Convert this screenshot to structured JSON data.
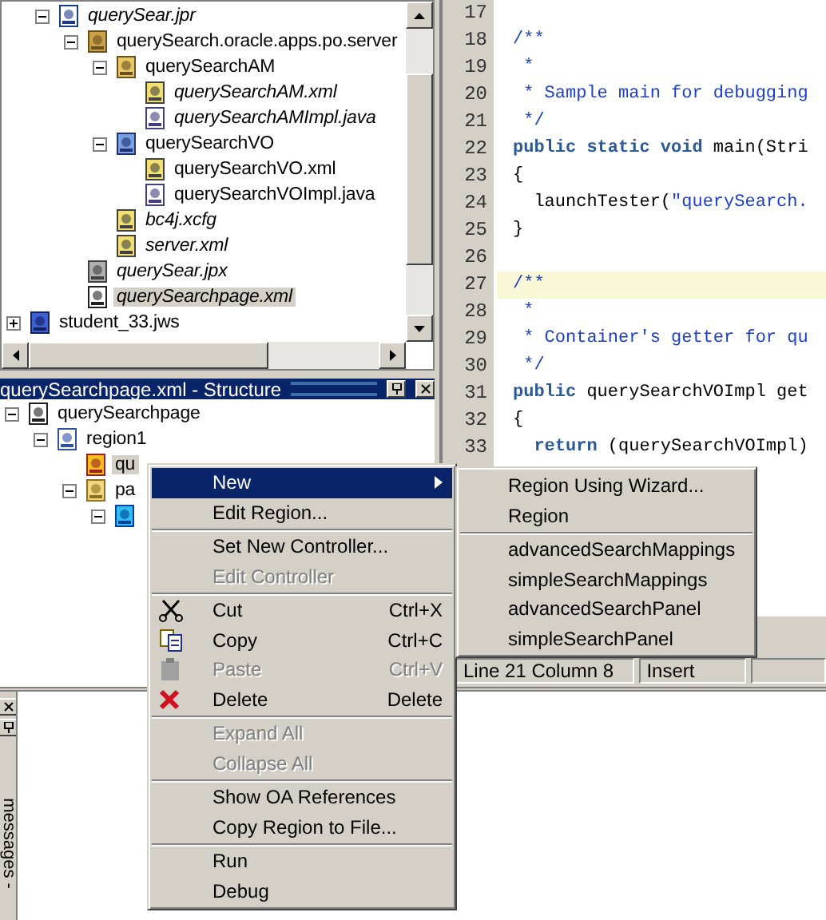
{
  "navigator": {
    "items": [
      {
        "label": "querySear.jpr",
        "kind": "project",
        "italic": true,
        "selected": false,
        "expanded": true,
        "children": [
          {
            "label": "querySearch.oracle.apps.po.server",
            "kind": "package",
            "italic": false,
            "selected": false,
            "expanded": true,
            "children": [
              {
                "label": "querySearchAM",
                "kind": "am",
                "italic": false,
                "selected": false,
                "expanded": true,
                "children": [
                  {
                    "label": "querySearchAM.xml",
                    "kind": "xml",
                    "italic": true,
                    "selected": false
                  },
                  {
                    "label": "querySearchAMImpl.java",
                    "kind": "java",
                    "italic": true,
                    "selected": false
                  }
                ]
              },
              {
                "label": "querySearchVO",
                "kind": "vo",
                "italic": false,
                "selected": false,
                "expanded": true,
                "children": [
                  {
                    "label": "querySearchVO.xml",
                    "kind": "xml",
                    "italic": false,
                    "selected": false
                  },
                  {
                    "label": "querySearchVOImpl.java",
                    "kind": "java",
                    "italic": false,
                    "selected": false
                  }
                ]
              },
              {
                "label": "bc4j.xcfg",
                "kind": "xml",
                "italic": true,
                "selected": false
              },
              {
                "label": "server.xml",
                "kind": "xml",
                "italic": true,
                "selected": false
              }
            ]
          },
          {
            "label": "querySear.jpx",
            "kind": "jpx",
            "italic": true,
            "selected": false
          },
          {
            "label": "querySearchpage.xml",
            "kind": "page",
            "italic": true,
            "selected": true
          }
        ]
      },
      {
        "label": "student_33.jws",
        "kind": "workspace",
        "italic": false,
        "selected": false,
        "expanded": false
      }
    ]
  },
  "structure": {
    "title": "querySearchpage.xml - Structure",
    "items": [
      {
        "label": "querySearchpage",
        "kind": "page",
        "italic": false,
        "selected": false,
        "expanded": true,
        "children": [
          {
            "label": "region1",
            "kind": "region",
            "italic": false,
            "selected": false,
            "expanded": true,
            "children": [
              {
                "label": "qu",
                "kind": "item",
                "italic": false,
                "selected": true
              },
              {
                "label": "pa",
                "kind": "folder",
                "italic": false,
                "selected": false,
                "expanded": true,
                "children": [
                  {
                    "kind": "table",
                    "expanded": true
                  }
                ]
              }
            ]
          }
        ]
      }
    ]
  },
  "editor": {
    "lines": [
      {
        "number": "17",
        "highlighted": false
      },
      {
        "number": "18",
        "highlighted": false,
        "tokens": [
          {
            "kind": "comment",
            "text": "/**"
          }
        ]
      },
      {
        "number": "19",
        "highlighted": false,
        "tokens": [
          {
            "kind": "comment",
            "text": " *"
          }
        ]
      },
      {
        "number": "20",
        "highlighted": false,
        "tokens": [
          {
            "kind": "comment",
            "text": " * Sample main for debugging"
          }
        ]
      },
      {
        "number": "21",
        "highlighted": false,
        "tokens": [
          {
            "kind": "comment",
            "text": " */"
          }
        ]
      },
      {
        "number": "22",
        "highlighted": false,
        "tokens": [
          {
            "kind": "keyword",
            "text": "public static void"
          },
          {
            "kind": "plain",
            "text": " main(Stri"
          }
        ]
      },
      {
        "number": "23",
        "highlighted": false,
        "tokens": [
          {
            "kind": "plain",
            "text": "{"
          }
        ]
      },
      {
        "number": "24",
        "highlighted": false,
        "tokens": [
          {
            "kind": "plain",
            "text": "  launchTester("
          },
          {
            "kind": "string",
            "text": "\"querySearch."
          }
        ]
      },
      {
        "number": "25",
        "highlighted": false,
        "tokens": [
          {
            "kind": "plain",
            "text": "}"
          }
        ]
      },
      {
        "number": "26",
        "highlighted": false
      },
      {
        "number": "27",
        "highlighted": true,
        "tokens": [
          {
            "kind": "comment",
            "text": "/**"
          }
        ]
      },
      {
        "number": "28",
        "highlighted": false,
        "tokens": [
          {
            "kind": "comment",
            "text": " *"
          }
        ]
      },
      {
        "number": "29",
        "highlighted": false,
        "tokens": [
          {
            "kind": "comment",
            "text": " * Container's getter for qu"
          }
        ]
      },
      {
        "number": "30",
        "highlighted": false,
        "tokens": [
          {
            "kind": "comment",
            "text": " */"
          }
        ]
      },
      {
        "number": "31",
        "highlighted": false,
        "tokens": [
          {
            "kind": "keyword",
            "text": "public"
          },
          {
            "kind": "plain",
            "text": " querySearchVOImpl get"
          }
        ]
      },
      {
        "number": "32",
        "highlighted": false,
        "tokens": [
          {
            "kind": "plain",
            "text": "{"
          }
        ]
      },
      {
        "number": "33",
        "highlighted": false,
        "tokens": [
          {
            "kind": "keyword",
            "text": "  return"
          },
          {
            "kind": "plain",
            "text": " (querySearchVOImpl)"
          }
        ]
      }
    ],
    "status": [
      "Line 21 Column 8",
      "Insert"
    ]
  },
  "log_panel": {
    "tab": "messages -"
  },
  "context_menu": [
    {
      "kind": "item",
      "label": "New",
      "submenu": true,
      "selected": true,
      "disabled": false
    },
    {
      "kind": "item",
      "label": "Edit Region...",
      "selected": false,
      "disabled": false
    },
    {
      "kind": "separator"
    },
    {
      "kind": "item",
      "label": "Set New Controller...",
      "selected": false,
      "disabled": false
    },
    {
      "kind": "item",
      "label": "Edit Controller",
      "selected": false,
      "disabled": true
    },
    {
      "kind": "separator"
    },
    {
      "kind": "cut",
      "label": "Cut",
      "shortcut": "Ctrl+X",
      "selected": false,
      "disabled": false
    },
    {
      "kind": "copy",
      "label": "Copy",
      "shortcut": "Ctrl+C",
      "selected": false,
      "disabled": false
    },
    {
      "kind": "paste",
      "label": "Paste",
      "shortcut": "Ctrl+V",
      "selected": false,
      "disabled": true
    },
    {
      "kind": "delete",
      "label": "Delete",
      "shortcut": "Delete",
      "selected": false,
      "disabled": false
    },
    {
      "kind": "separator"
    },
    {
      "kind": "item",
      "label": "Expand All",
      "selected": false,
      "disabled": true
    },
    {
      "kind": "item",
      "label": "Collapse All",
      "selected": false,
      "disabled": true
    },
    {
      "kind": "separator"
    },
    {
      "kind": "item",
      "label": "Show OA References",
      "selected": false,
      "disabled": false
    },
    {
      "kind": "item",
      "label": "Copy Region to File...",
      "selected": false,
      "disabled": false
    },
    {
      "kind": "separator"
    },
    {
      "kind": "item",
      "label": "Run",
      "selected": false,
      "disabled": false
    },
    {
      "kind": "item",
      "label": "Debug",
      "selected": false,
      "disabled": false
    }
  ],
  "submenu": [
    {
      "kind": "item",
      "label": "Region Using Wizard...",
      "selected": false,
      "disabled": false
    },
    {
      "kind": "item",
      "label": "Region",
      "selected": false,
      "disabled": false
    },
    {
      "kind": "separator"
    },
    {
      "kind": "item",
      "label": "advancedSearchMappings",
      "selected": false,
      "disabled": false
    },
    {
      "kind": "item",
      "label": "simpleSearchMappings",
      "selected": false,
      "disabled": false
    },
    {
      "kind": "item",
      "label": "advancedSearchPanel",
      "selected": false,
      "disabled": false
    },
    {
      "kind": "item",
      "label": "simpleSearchPanel",
      "selected": false,
      "disabled": false
    }
  ]
}
